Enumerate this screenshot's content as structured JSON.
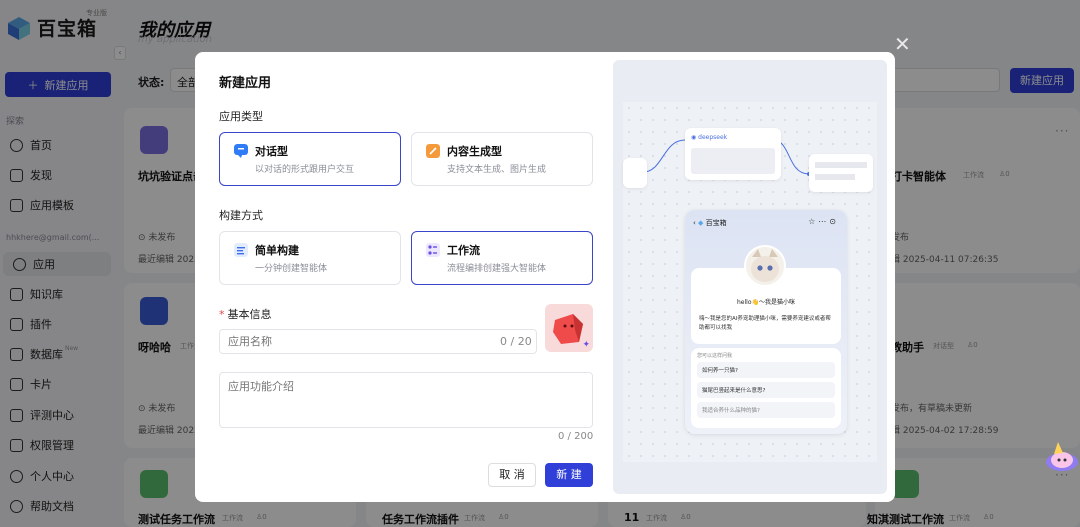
{
  "app": {
    "logo_text": "百宝箱",
    "logo_badge": "专业版",
    "new_app_label": "新建应用",
    "page_title": "我的应用",
    "page_subtitle": "my application",
    "status_label": "状态:",
    "status_value": "全部",
    "new_app_top_label": "新建应用"
  },
  "sidebar": {
    "explore_section": "探索",
    "account_section": "hhkhere@gmail.com(...",
    "new_tag": "New",
    "items": [
      {
        "label": "首页",
        "icon": "compass-icon"
      },
      {
        "label": "发现",
        "icon": "home-icon"
      },
      {
        "label": "应用模板",
        "icon": "template-icon"
      },
      {
        "label": "应用",
        "icon": "app-icon"
      },
      {
        "label": "知识库",
        "icon": "folder-icon"
      },
      {
        "label": "插件",
        "icon": "plugin-icon"
      },
      {
        "label": "数据库",
        "icon": "database-icon"
      },
      {
        "label": "卡片",
        "icon": "card-icon"
      },
      {
        "label": "评测中心",
        "icon": "chart-icon"
      },
      {
        "label": "权限管理",
        "icon": "shield-icon"
      },
      {
        "label": "个人中心",
        "icon": "user-icon"
      },
      {
        "label": "帮助文档",
        "icon": "help-icon"
      }
    ]
  },
  "cards": [
    {
      "title": "坑坑验证点击",
      "tag": "",
      "status": "未发布",
      "edited": "最近编辑 2025"
    },
    {
      "title": "呀哈哈",
      "tag": "工作流",
      "status": "未发布",
      "edited": "最近编辑 2025"
    },
    {
      "title": "测试任务工作流",
      "tag": "工作流",
      "count": "0"
    },
    {
      "title": "任务工作流插件",
      "tag": "工作流",
      "count": "0"
    },
    {
      "title": "11",
      "tag": "工作流",
      "count": "0"
    },
    {
      "title": "知淇测试工作流",
      "tag": "工作流",
      "count": "0"
    },
    {
      "title": "打卡智能体",
      "tag": "工作流",
      "count": "0",
      "status": "发布",
      "edited": "辑 2025-04-11 07:26:35"
    },
    {
      "title": "教助手",
      "tag": "对话型",
      "count": "0",
      "status": "发布，有草稿未更新",
      "edited": "辑 2025-04-02 17:28:59"
    }
  ],
  "modal": {
    "title": "新建应用",
    "type_section": "应用类型",
    "type_options": [
      {
        "name": "对话型",
        "desc": "以对话的形式跟用户交互",
        "icon": "chat-icon",
        "selected": true
      },
      {
        "name": "内容生成型",
        "desc": "支持文本生成、图片生成",
        "icon": "pen-icon",
        "selected": false
      }
    ],
    "build_section": "构建方式",
    "build_options": [
      {
        "name": "简单构建",
        "desc": "一分钟创建智能体",
        "icon": "list-icon",
        "selected": false
      },
      {
        "name": "工作流",
        "desc": "流程编排创建强大智能体",
        "icon": "workflow-icon",
        "selected": true
      }
    ],
    "basic_section": "基本信息",
    "name_placeholder": "应用名称",
    "name_count": "0 / 20",
    "desc_placeholder": "应用功能介绍",
    "desc_count": "0 / 200",
    "cancel_label": "取 消",
    "create_label": "新 建"
  },
  "preview": {
    "node_label": "deepseek",
    "phone_title": "百宝箱",
    "hello_text": "hello👋～我是猫小咪",
    "intro_text": "嗨～我是您的AI养宠助理猫小咪，需要养宠建议或者帮助都可以找我",
    "ask_title": "您可以这样问我",
    "questions": [
      "如何养一只猫?",
      "猫尾巴竖起来是什么意思?",
      "我适合养什么品种的猫?"
    ]
  },
  "colors": {
    "primary": "#2f3fd8",
    "selected_border": "#3a45c9"
  }
}
